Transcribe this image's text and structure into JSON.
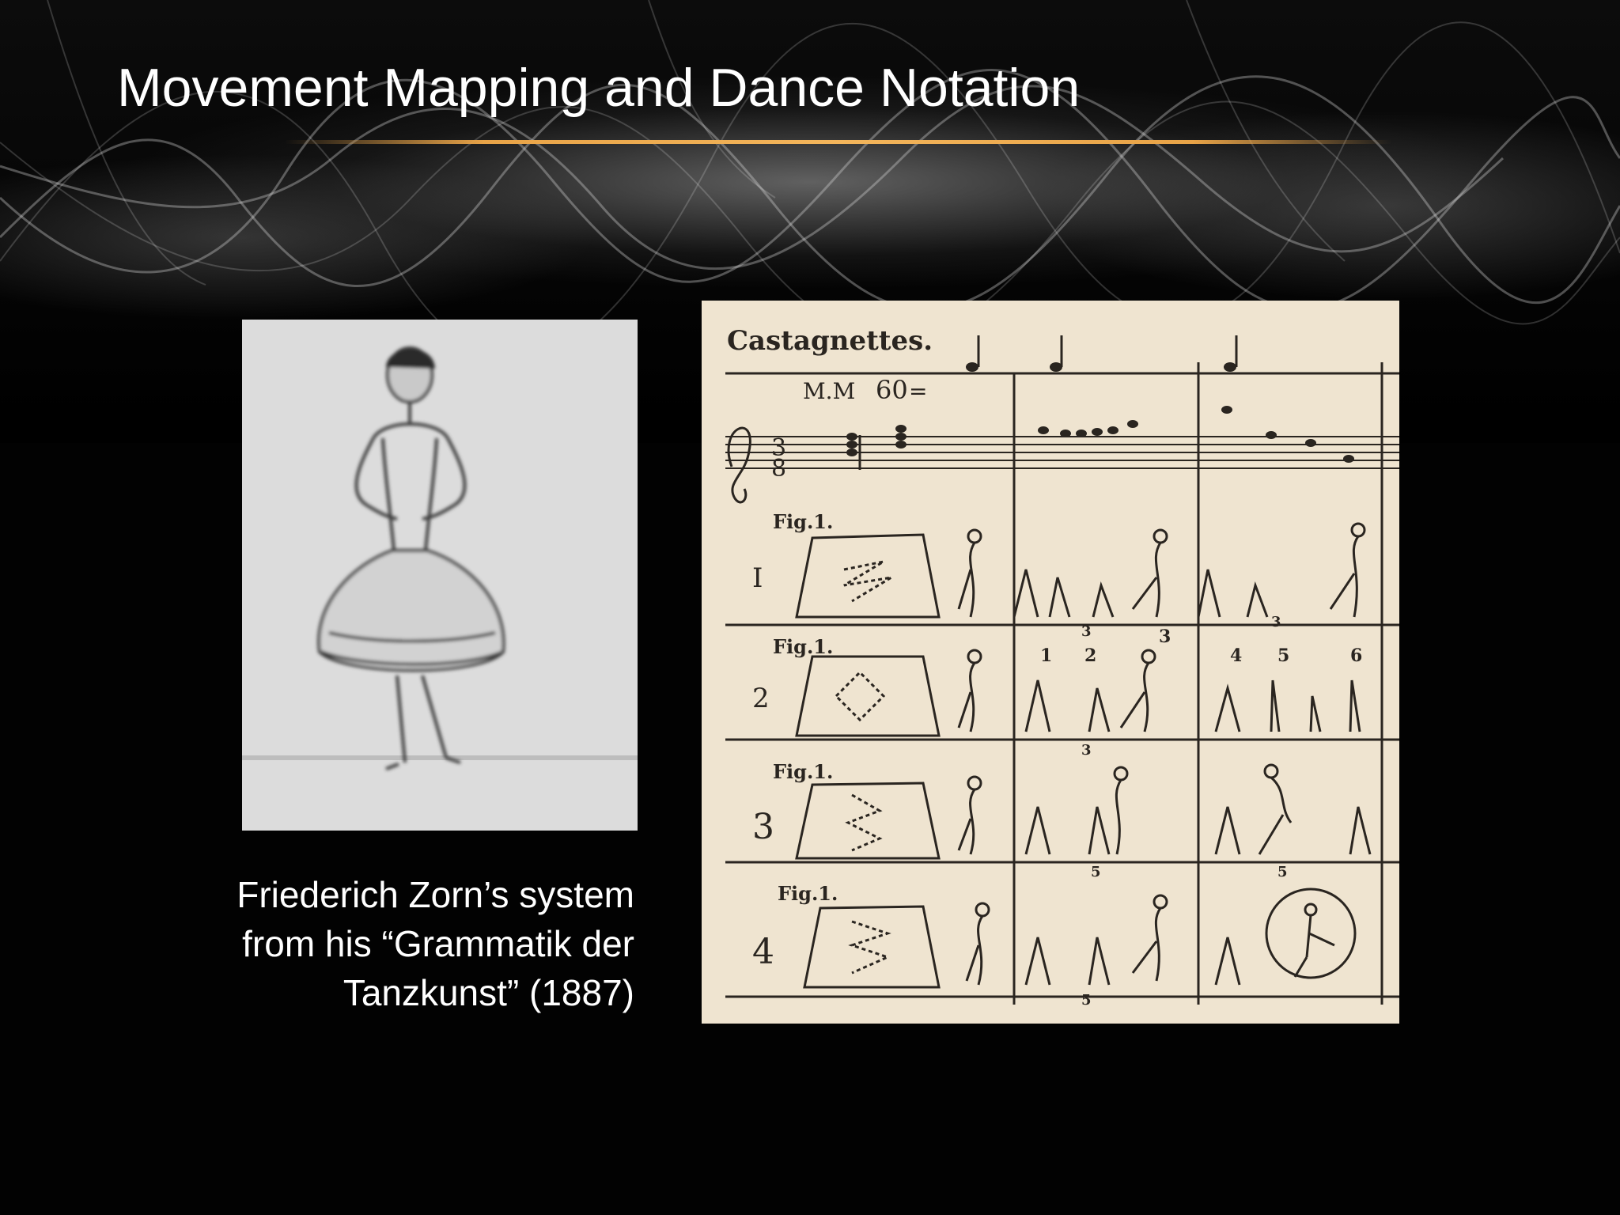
{
  "slide": {
    "title": "Movement Mapping and Dance Notation",
    "caption": [
      "Friederich Zorn’s system",
      "from his “Grammatik der",
      "Tanzkunst” (1887)"
    ],
    "accent_color": "#e8a347"
  },
  "portrait": {
    "icon": "dancer-figure-icon"
  },
  "notation": {
    "header": "Castagnettes.",
    "tempo_label": "M.M",
    "tempo_value": "60",
    "tempo_eq": "=",
    "rows": [
      {
        "fig": "Fig.1.",
        "label": "I"
      },
      {
        "fig": "Fig.1.",
        "label": "2"
      },
      {
        "fig": "Fig.1.",
        "label": "3"
      },
      {
        "fig": "Fig.1.",
        "label": "4"
      }
    ],
    "counts_row2": [
      "1",
      "2",
      "3",
      "4",
      "5",
      "6"
    ],
    "beat_marks": [
      "3",
      "3",
      "3",
      "5",
      "5",
      "5"
    ]
  }
}
